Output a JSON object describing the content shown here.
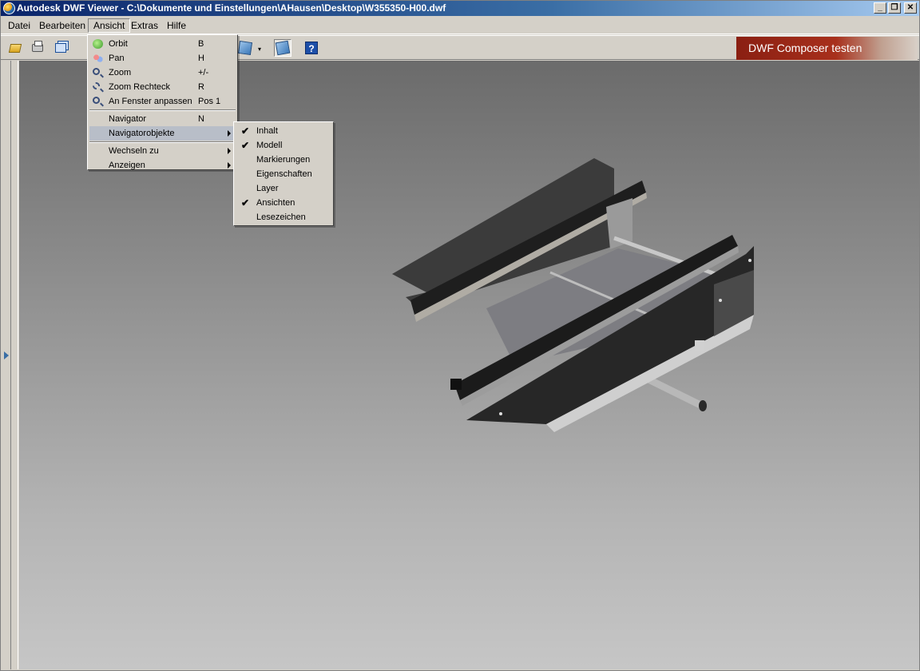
{
  "window": {
    "title": "Autodesk DWF Viewer - C:\\Dokumente und Einstellungen\\AHausen\\Desktop\\W355350-H00.dwf",
    "minimize": "_",
    "maximize": "❐",
    "close": "✕"
  },
  "menubar": {
    "items": [
      {
        "label": "Datei"
      },
      {
        "label": "Bearbeiten"
      },
      {
        "label": "Ansicht"
      },
      {
        "label": "Extras"
      },
      {
        "label": "Hilfe"
      }
    ]
  },
  "toolbar": {
    "banner_label": "DWF Composer testen",
    "help_label": "?",
    "dropdown_arrow": "▾"
  },
  "ansicht_menu": {
    "items": [
      {
        "label": "Orbit",
        "shortcut": "B",
        "icon": "orbit-icon"
      },
      {
        "label": "Pan",
        "shortcut": "H",
        "icon": "pan-icon"
      },
      {
        "label": "Zoom",
        "shortcut": "+/-",
        "icon": "zoom-icon"
      },
      {
        "label": "Zoom Rechteck",
        "shortcut": "R",
        "icon": "zoom-rectangle-icon"
      },
      {
        "label": "An Fenster anpassen",
        "shortcut": "Pos 1",
        "icon": "fit-window-icon"
      },
      {
        "label": "Navigator",
        "shortcut": "N"
      },
      {
        "label": "Navigatorobjekte",
        "submenu": true,
        "highlighted": true
      },
      {
        "label": "Wechseln zu",
        "submenu": true
      },
      {
        "label": "Anzeigen",
        "submenu": true
      }
    ]
  },
  "navigator_submenu": {
    "check_mark": "✔",
    "items": [
      {
        "label": "Inhalt",
        "checked": true
      },
      {
        "label": "Modell",
        "checked": true
      },
      {
        "label": "Markierungen",
        "checked": false
      },
      {
        "label": "Eigenschaften",
        "checked": false
      },
      {
        "label": "Layer",
        "checked": false
      },
      {
        "label": "Ansichten",
        "checked": true
      },
      {
        "label": "Lesezeichen",
        "checked": false
      }
    ]
  },
  "colors": {
    "titlebar_start": "#0a246a",
    "titlebar_end": "#a6caf0",
    "chrome": "#d4d0c8",
    "menu_highlight": "#b8bec8",
    "banner": "#a8301c"
  }
}
